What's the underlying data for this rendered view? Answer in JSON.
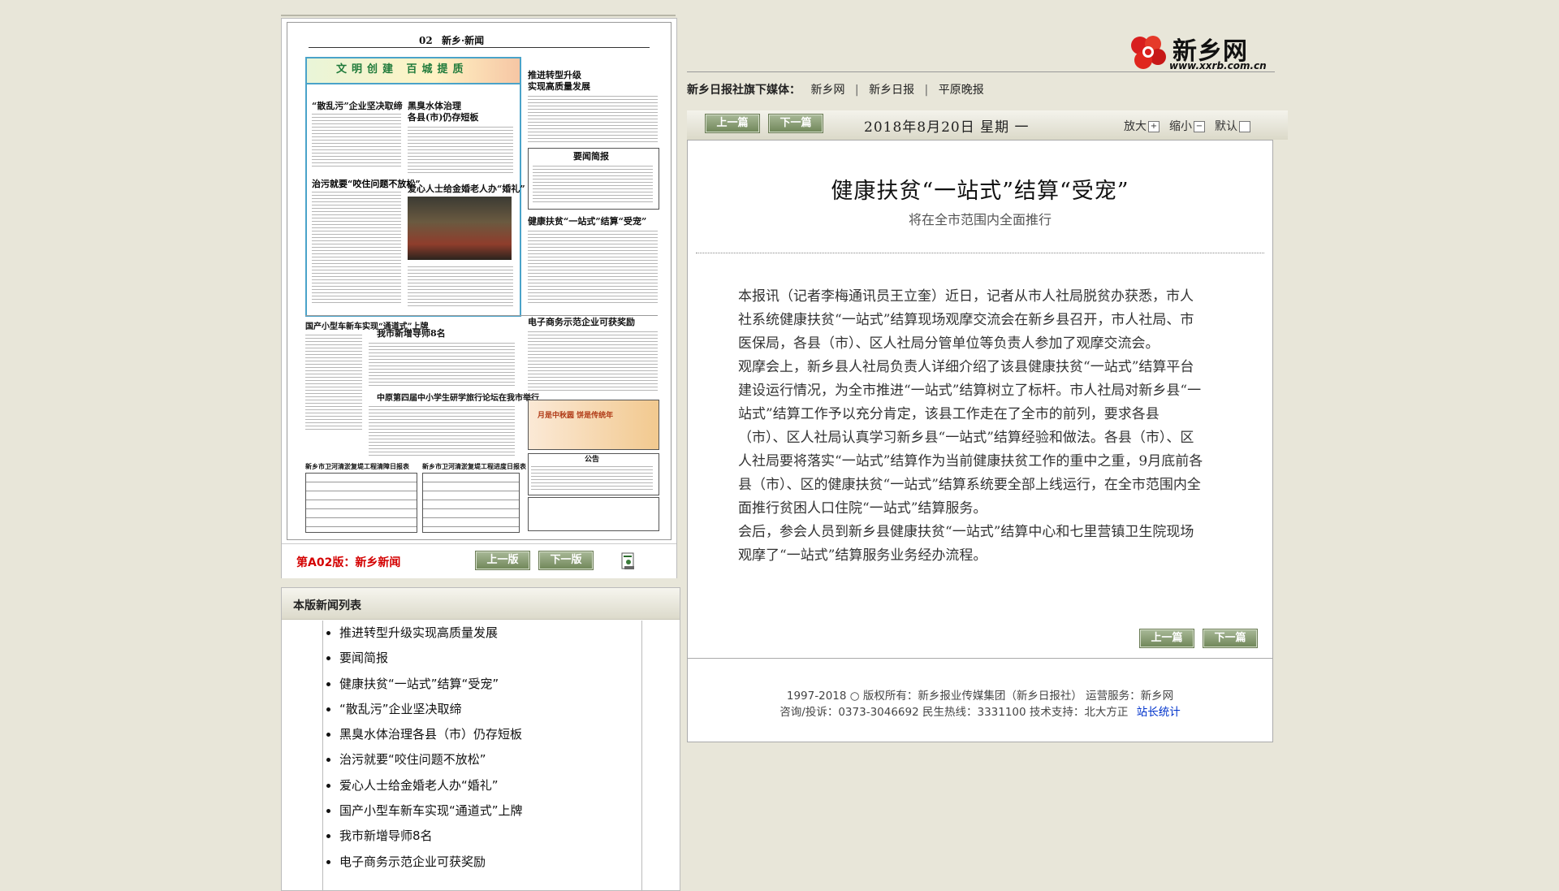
{
  "newspaper": {
    "page_no": "02",
    "section": "新乡·新闻",
    "banner_text": "文明创建  百城提质",
    "thumb_headlines": [
      "推进转型升级",
      "实现高质量发展",
      "“散乱污”企业坚决取缔",
      "黑臭水体治理",
      "各县(市)仍存短板",
      "要闻简报",
      "治污就要“咬住问题不放松”",
      "爱心人士给金婚老人办“婚礼”",
      "健康扶贫“一站式”结算“受宠”",
      "国产小型车新车实现“通道式”上牌",
      "我市新增导师8名",
      "电子商务示范企业可获奖励",
      "中原第四届中小学生研学旅行论坛在我市举行",
      "月是中秋圆 饼是传统年",
      "公告",
      "新乡市卫河清淤复堤工程清障日报表",
      "新乡市卫河清淤复堤工程进度日报表"
    ]
  },
  "pagebar": {
    "edition": "第A02版：新乡新闻",
    "prev_page": "上一版",
    "next_page": "下一版"
  },
  "news_list": {
    "title": "本版新闻列表",
    "items": [
      "推进转型升级实现高质量发展",
      "要闻简报",
      "健康扶贫“一站式”结算“受宠”",
      "“散乱污”企业坚决取缔",
      "黑臭水体治理各县（市）仍存短板",
      "治污就要“咬住问题不放松”",
      "爱心人士给金婚老人办“婚礼”",
      "国产小型车新车实现“通道式”上牌",
      "我市新增导师8名",
      "电子商务示范企业可获奖励"
    ]
  },
  "logo": {
    "title": "新乡网",
    "url": "www.xxrb.com.cn"
  },
  "media": {
    "label": "新乡日报社旗下媒体：",
    "links": [
      "新乡网",
      "新乡日报",
      "平原晚报"
    ]
  },
  "toolbar": {
    "prev_article": "上一篇",
    "next_article": "下一篇",
    "date": "2018年8月20日  星期 一",
    "zoom_in": "放大",
    "zoom_out": "缩小",
    "default": "默认"
  },
  "article": {
    "title": "健康扶贫“一站式”结算“受宠”",
    "subtitle": "将在全市范围内全面推行",
    "paragraphs": [
      "本报讯（记者李梅通讯员王立奎）近日，记者从市人社局脱贫办获悉，市人社系统健康扶贫“一站式”结算现场观摩交流会在新乡县召开，市人社局、市医保局，各县（市）、区人社局分管单位等负责人参加了观摩交流会。",
      "观摩会上，新乡县人社局负责人详细介绍了该县健康扶贫“一站式”结算平台建设运行情况，为全市推进“一站式”结算树立了标杆。市人社局对新乡县“一站式”结算工作予以充分肯定，该县工作走在了全市的前列，要求各县（市）、区人社局认真学习新乡县“一站式”结算经验和做法。各县（市）、区人社局要将落实“一站式”结算作为当前健康扶贫工作的重中之重，9月底前各县（市）、区的健康扶贫“一站式”结算系统要全部上线运行，在全市范围内全面推行贫困人口住院“一站式”结算服务。",
      "会后，参会人员到新乡县健康扶贫“一站式”结算中心和七里营镇卫生院现场观摩了“一站式”结算服务业务经办流程。"
    ],
    "prev_article": "上一篇",
    "next_article": "下一篇"
  },
  "footer": {
    "line1": "1997-2018 ○ 版权所有：新乡报业传媒集团（新乡日报社） 运营服务：新乡网",
    "line2": "咨询/投诉：0373-3046692 民生热线：3331100 技术支持：北大方正",
    "stats_link": "站长统计"
  }
}
